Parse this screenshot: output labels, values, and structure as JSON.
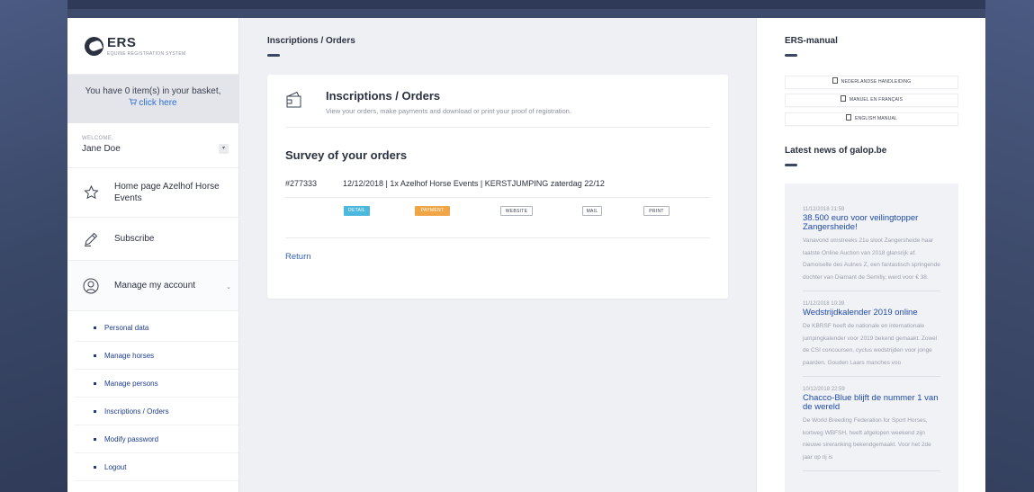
{
  "sidebar": {
    "logo": {
      "name": "ERS",
      "subtitle": "EQUINE REGISTRATION SYSTEM"
    },
    "basket": {
      "text": "You have 0 item(s) in your basket,",
      "link": "click here"
    },
    "welcome": {
      "label": "WELCOME,",
      "user": "Jane Doe"
    },
    "nav": {
      "home": "Home page Azelhof Horse Events",
      "subscribe": "Subscribe",
      "account": "Manage my account"
    },
    "sub_items": [
      "Personal data",
      "Manage horses",
      "Manage persons",
      "Inscriptions / Orders",
      "Modify password",
      "Logout"
    ]
  },
  "main": {
    "breadcrumb": "Inscriptions / Orders",
    "card_title": "Inscriptions / Orders",
    "card_desc": "View your orders, make payments and download or print your proof of registration.",
    "survey_title": "Survey of your orders",
    "order": {
      "number": "#277333",
      "info": "12/12/2018 | 1x Azelhof Horse Events | KERSTJUMPING zaterdag 22/12"
    },
    "buttons": {
      "detail": "DETAIL",
      "payment": "PAYMENT",
      "website": "WEBSITE",
      "mail": "MAIL",
      "print": "PRINT"
    },
    "return": "Return"
  },
  "right": {
    "manual_title": "ERS-manual",
    "manuals": [
      "NEDERLANDSE HANDLEIDING",
      "MANUEL EN FRANÇAIS",
      "ENGLISH MANUAL"
    ],
    "news_title": "Latest news of galop.be",
    "news": [
      {
        "date": "11/12/2018 21:59",
        "title": "38.500 euro voor veilingtopper Zangersheide!",
        "body": "Vanavond omstreeks 21u sloot Zangersheide haar laatste Online Auction van 2018 glansrijk af. Damoiselle des Aulnes Z, een fantastisch springende dochter van Diamant de Semilly, werd voor € 38."
      },
      {
        "date": "11/12/2018 10:39",
        "title": "Wedstrijdkalender 2019 online",
        "body": "De KBRSF heeft de nationale en internationale jumpingkalender voor 2019 bekend gemaakt. Zowel de CSI concoursen, cyclus wedstrijden voor jonge paarden, Gouden Laars manches voo"
      },
      {
        "date": "10/12/2018 22:59",
        "title": "Chacco-Blue blijft de nummer 1 van de wereld",
        "body": "De World Breeding Federation for Sport Horses, kortweg WBFSH, heeft afgelopen weekend zijn nieuwe sireranking bekendgemaakt. Voor het 2de jaar op rij is"
      }
    ]
  },
  "colors": {
    "accent_blue": "#1f4aa8",
    "detail_button": "#4bb8dc",
    "payment_button": "#f0a547",
    "background": "#3d4a6a"
  },
  "icons": [
    "star-icon",
    "pencil-icon",
    "user-circle-icon",
    "wallet-icon",
    "cart-icon",
    "pdf-icon",
    "chevron-down-icon"
  ]
}
